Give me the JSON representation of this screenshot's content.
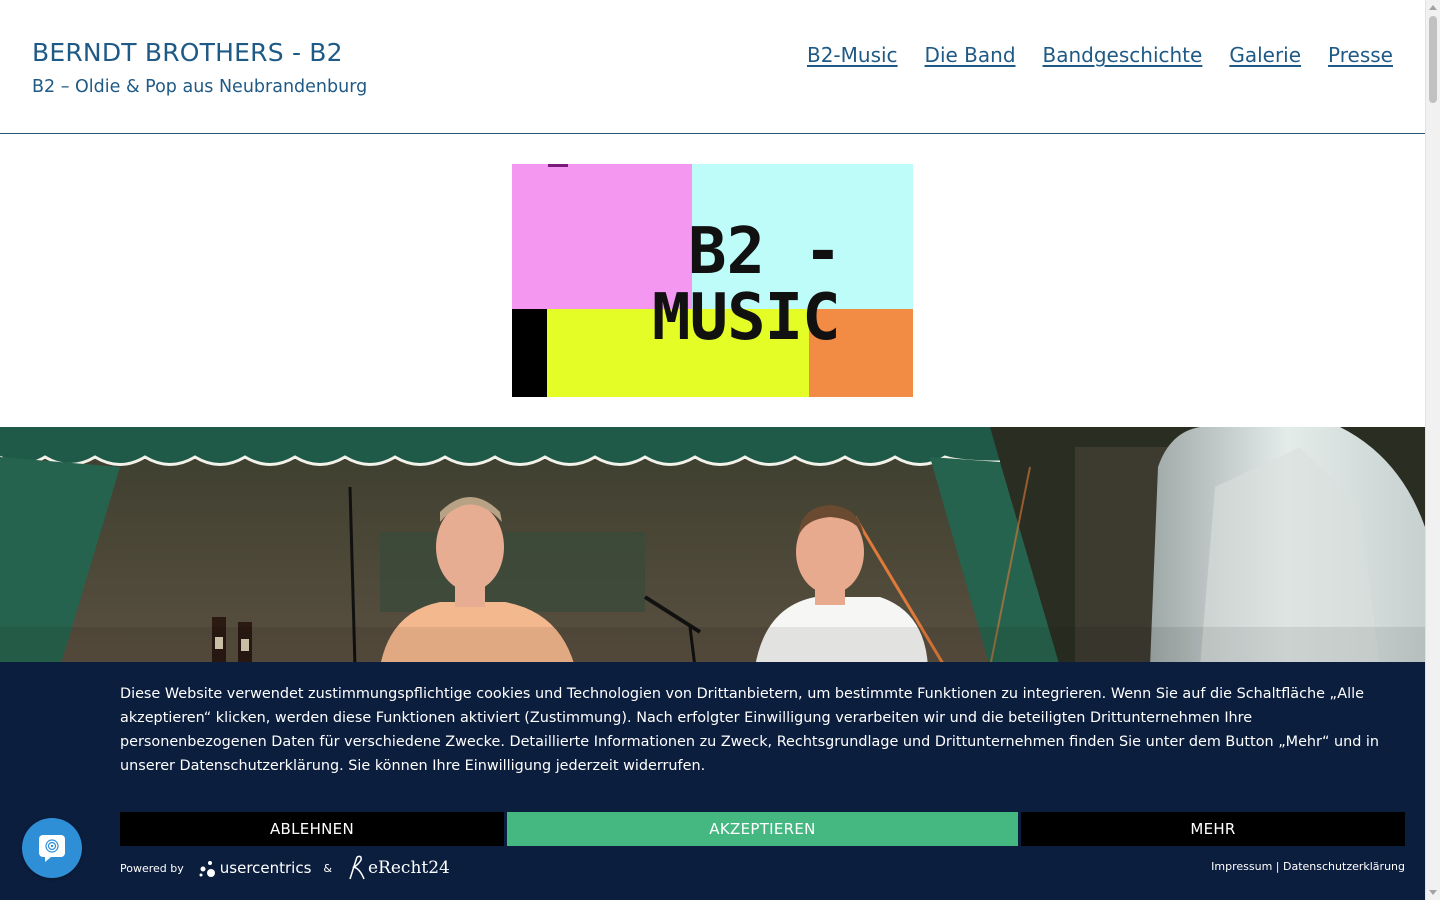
{
  "header": {
    "site_title": "BERNDT BROTHERS - B2",
    "tagline": "B2 – Oldie & Pop aus Neubrandenburg",
    "nav": [
      "B2-Music",
      "Die Band",
      "Bandgeschichte",
      "Galerie",
      "Presse"
    ]
  },
  "logo": {
    "line1": "B2 -",
    "line2": "MUSIC",
    "colors": {
      "pink": "#f497f0",
      "cyan": "#bdfcf9",
      "yellow": "#e5fd26",
      "orange": "#f28b43",
      "black": "#000000"
    }
  },
  "hero": {
    "description_icon": "band-photo"
  },
  "cookie_banner": {
    "text": "Diese Website verwendet zustimmungspflichtige cookies und Technologien von Drittanbietern, um bestimmte Funktionen zu integrieren. Wenn Sie auf die Schaltfläche „Alle akzeptieren“ klicken, werden diese Funktionen aktiviert (Zustimmung). Nach erfolgter Einwilligung verarbeiten wir und die beteiligten Drittunternehmen Ihre personenbezogenen Daten für verschiedene Zwecke. Detaillierte Informationen zu Zweck, Rechtsgrundlage und Drittunternehmen finden Sie unter dem Button „Mehr“ und in unserer Datenschutzerklärung. Sie können Ihre Einwilligung jederzeit widerrufen.",
    "deny_label": "ABLEHNEN",
    "accept_label": "AKZEPTIEREN",
    "more_label": "MEHR",
    "powered_by": "Powered by",
    "usercentrics": "usercentrics",
    "ampersand": "&",
    "erecht": "eRecht24",
    "impressum": "Impressum",
    "separator": "|",
    "datenschutz": "Datenschutzerklärung",
    "accent_color": "#45b882",
    "background_color": "#0c1e3e"
  },
  "privacy_fab": {
    "icon": "fingerprint-icon"
  }
}
